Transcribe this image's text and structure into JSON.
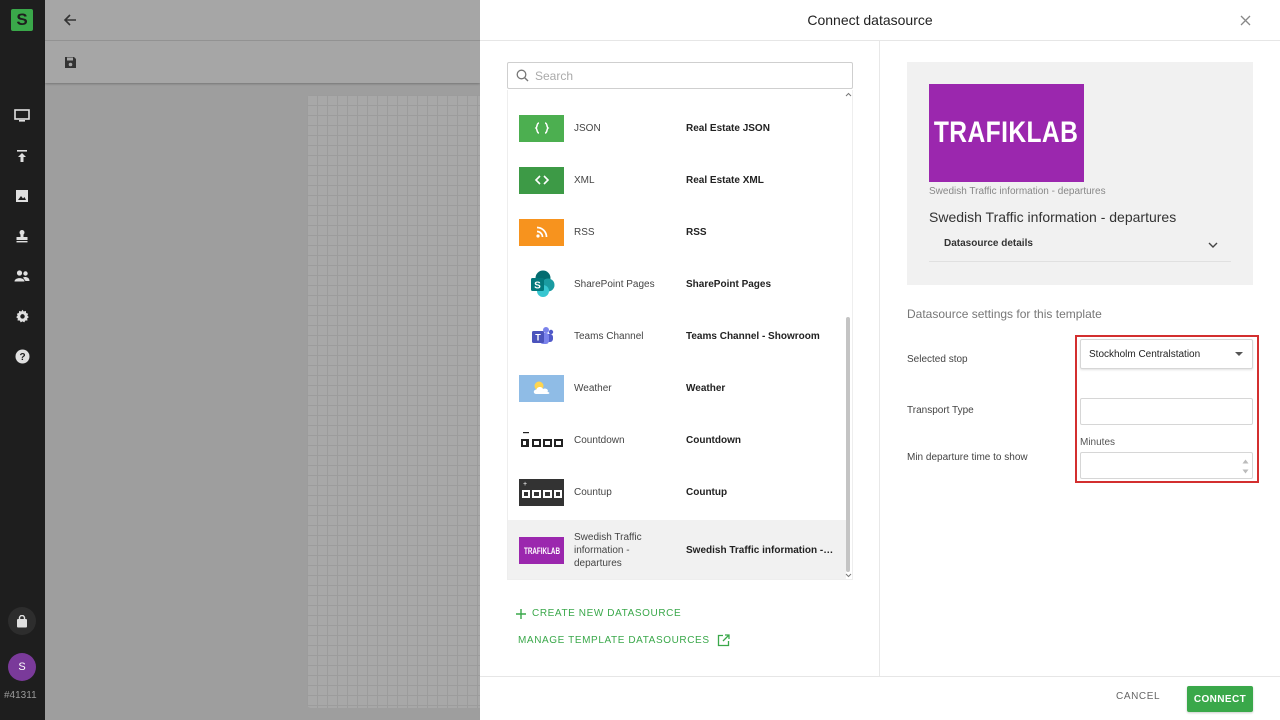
{
  "app": {
    "logo_letter": "S",
    "version_label": "#41311",
    "user_initial": "S",
    "rail_icons": [
      "monitor-icon",
      "upload-icon",
      "image-icon",
      "stamp-icon",
      "users-icon",
      "gear-icon",
      "help-icon"
    ]
  },
  "dialog": {
    "title": "Connect datasource",
    "search_placeholder": "Search",
    "datasources": [
      {
        "name": "JSON",
        "description": "Real Estate JSON",
        "icon": "json-icon",
        "color": "#4caf50"
      },
      {
        "name": "XML",
        "description": "Real Estate XML",
        "icon": "xml-icon",
        "color": "#3d9a46"
      },
      {
        "name": "RSS",
        "description": "RSS",
        "icon": "rss-icon",
        "color": "#f7931e"
      },
      {
        "name": "SharePoint Pages",
        "description": "SharePoint Pages",
        "icon": "sharepoint-icon",
        "color": "#038387"
      },
      {
        "name": "Teams Channel",
        "description": "Teams Channel - Showroom",
        "icon": "teams-icon",
        "color": "#5059c9"
      },
      {
        "name": "Weather",
        "description": "Weather",
        "icon": "weather-icon",
        "color": "#6fa8dc"
      },
      {
        "name": "Countdown",
        "description": "Countdown",
        "icon": "countdown-icon",
        "color": "#222222"
      },
      {
        "name": "Countup",
        "description": "Countup",
        "icon": "countup-icon",
        "color": "#222222"
      },
      {
        "name": "Swedish Traffic information - departures",
        "description": "Swedish Traffic information - departures",
        "icon": "trafiklab-icon",
        "color": "#9b27ae",
        "selected": true
      }
    ],
    "create_link": "CREATE NEW DATASOURCE",
    "manage_link": "MANAGE TEMPLATE DATASOURCES",
    "preview": {
      "logo_text": "TRAFIKLAB",
      "caption": "Swedish Traffic information - departures",
      "title": "Swedish Traffic information - departures",
      "details_label": "Datasource details"
    },
    "settings": {
      "heading": "Datasource settings for this template",
      "selected_stop_label": "Selected stop",
      "selected_stop_value": "Stockholm Centralstation",
      "transport_type_label": "Transport Type",
      "transport_type_value": "",
      "min_departure_label": "Min departure time to show",
      "minutes_label": "Minutes",
      "min_departure_value": ""
    },
    "cancel_label": "CANCEL",
    "connect_label": "CONNECT",
    "accent": "#3aa84a",
    "highlight": "#d32f2f"
  }
}
